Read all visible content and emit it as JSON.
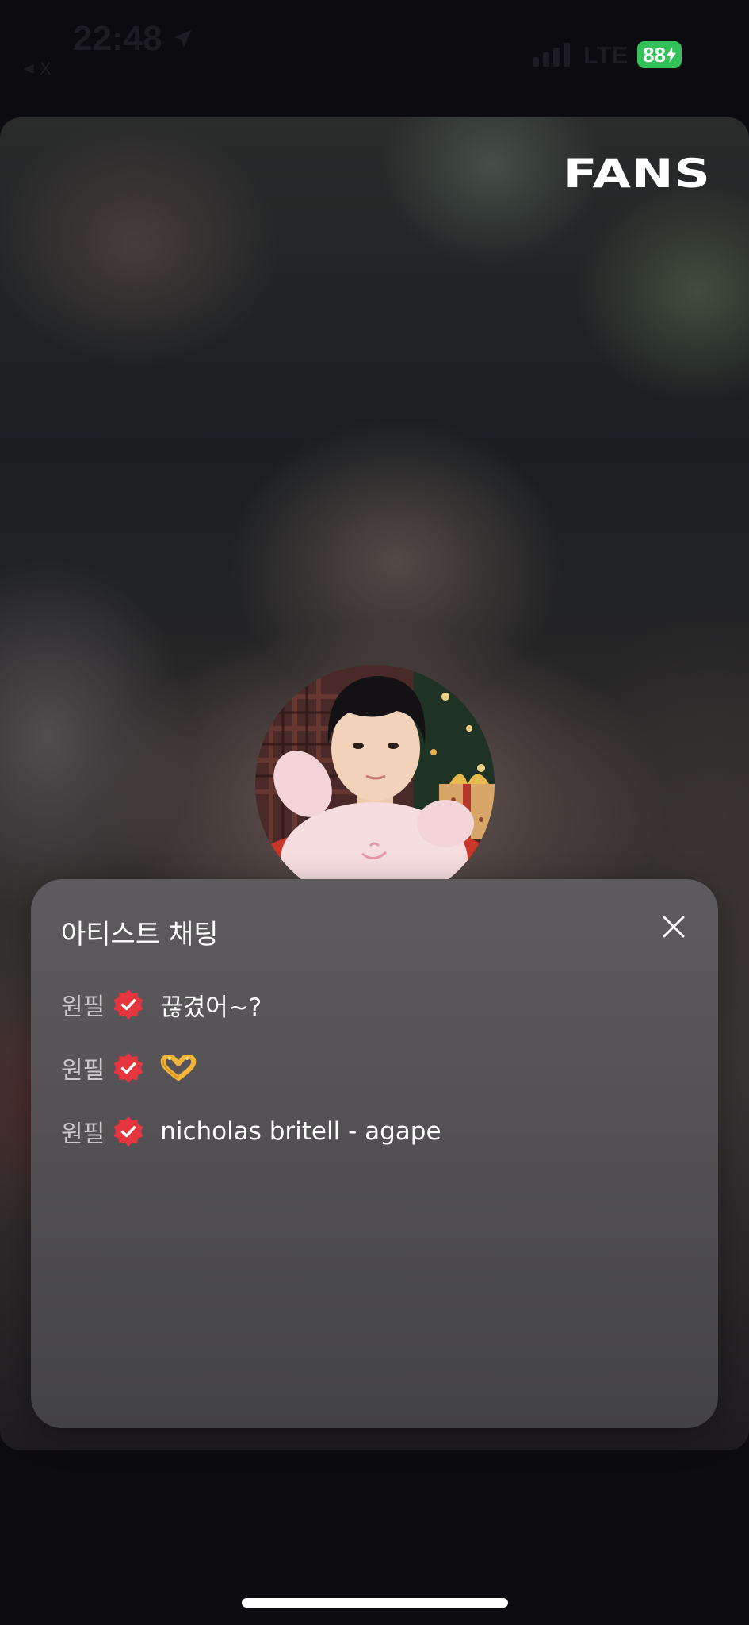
{
  "status_bar": {
    "time": "22:48",
    "back_label": "X",
    "network": "LTE",
    "battery": "88"
  },
  "brand": {
    "logo_text": "FANS"
  },
  "chat_panel": {
    "title": "아티스트 채팅",
    "messages": [
      {
        "sender": "원필",
        "text": "끊겼어~?"
      },
      {
        "sender": "원필",
        "text": "",
        "emoji": "heart-hands"
      },
      {
        "sender": "원필",
        "text": "nicholas britell - agape"
      }
    ]
  },
  "colors": {
    "verified_badge": "#e5353f",
    "battery": "#33c159",
    "panel": "#535154"
  }
}
